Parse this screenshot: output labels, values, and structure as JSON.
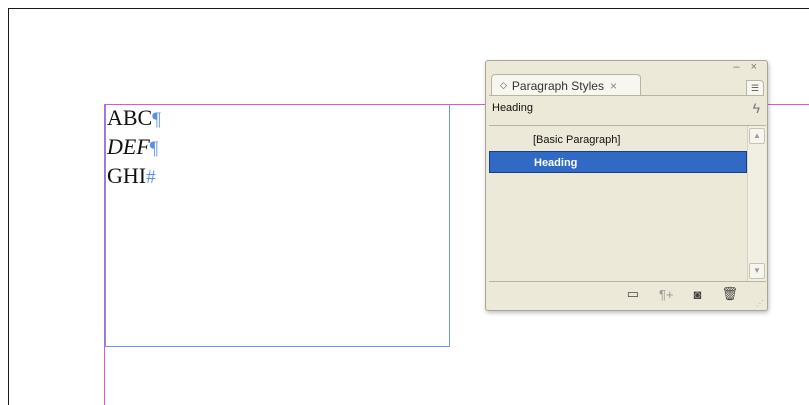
{
  "document": {
    "lines": [
      {
        "text": "ABC",
        "mark": "¶"
      },
      {
        "text": "DEF",
        "mark": "¶"
      },
      {
        "text": "GHI",
        "mark": "#"
      }
    ],
    "colors": {
      "margin": "#d65ad6",
      "frame": "#6a98e8",
      "hidden_chars": "#5b8fe6"
    }
  },
  "panel": {
    "tab_label": "Paragraph Styles",
    "tab_close": "×",
    "window_controls": "– ×",
    "current_style": "Heading",
    "styles": [
      {
        "label": "[Basic Paragraph]",
        "selected": false
      },
      {
        "label": "Heading",
        "selected": true
      }
    ],
    "icons": {
      "menu": "panel-menu-icon",
      "lightning": "lightning-icon",
      "folder": "new-group-icon",
      "clear": "clear-overrides-icon",
      "new": "new-style-icon",
      "trash": "delete-style-icon"
    },
    "selected_color": "#316ac5"
  }
}
